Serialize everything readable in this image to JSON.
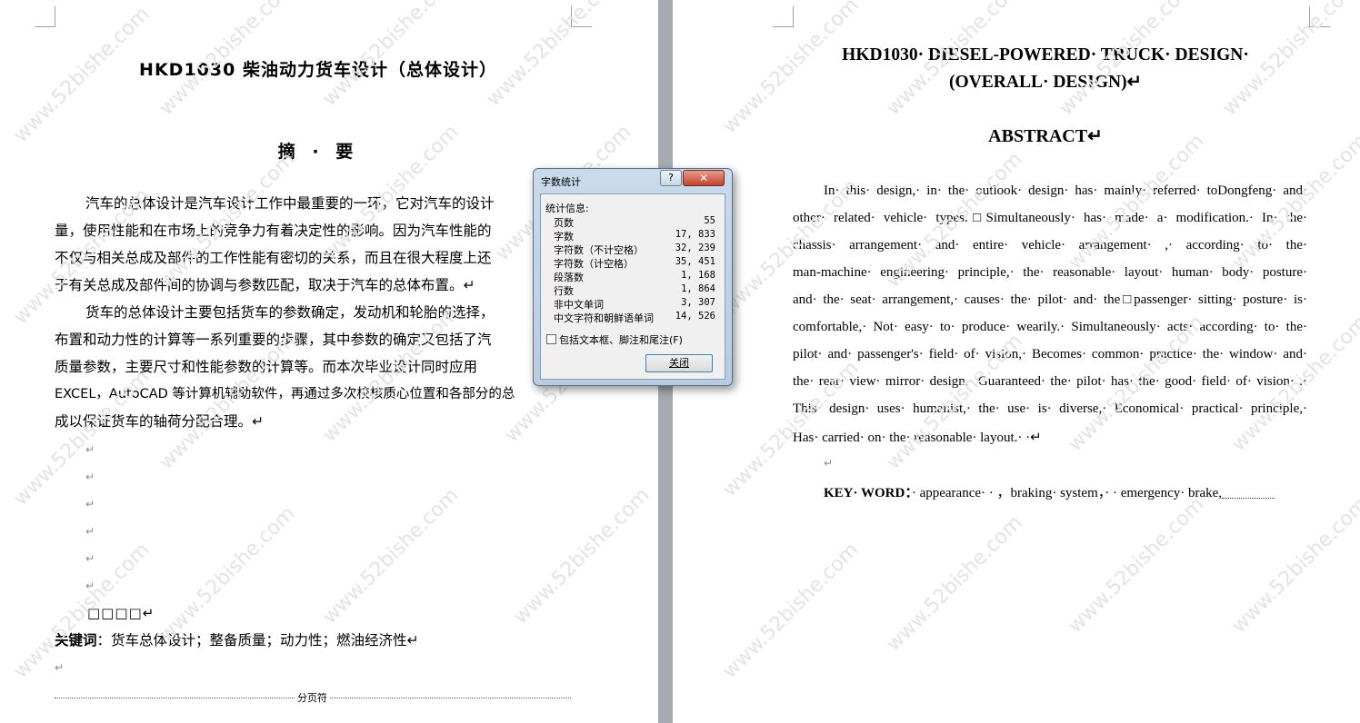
{
  "watermark": "www.52bishe.com",
  "paragraph_mark": "↵",
  "left_page": {
    "title": "HKD1030 柴油动力货车设计（总体设计）",
    "abstract_heading": "摘 · 要",
    "lines": [
      "汽车的总体设计是汽车设计工作中最重要的一环，它对汽车的设计",
      "量，使用性能和在市场上的竞争力有着决定性的影响。因为汽车性能的",
      "不仅与相关总成及部件的工作性能有密切的关系，而且在很大程度上还",
      "于有关总成及部件间的协调与参数匹配，取决于汽车的总体布置。↵",
      "货车的总体设计主要包括货车的参数确定，发动机和轮胎的选择，",
      "布置和动力性的计算等一系列重要的步骤，其中参数的确定又包括了汽",
      "质量参数，主要尺寸和性能参数的计算等。而本次毕业设计同时应用",
      "EXCEL，AutoCAD 等计算机辅助软件，再通过多次校核质心位置和各部分的总",
      "成以保证货车的轴荷分配合理。↵"
    ],
    "placeholder_boxes": "□□□□↵",
    "keywords_label": "关键词",
    "keywords_text": "：货车总体设计；整备质量；动力性；燃油经济性↵",
    "page_break_label": "分页符"
  },
  "right_page": {
    "title_line1": "HKD1030· DIESEL-POWERED· TRUCK· DESIGN·",
    "title_line2": "(OVERALL· DESIGN)↵",
    "abstract_heading": "ABSTRACT↵",
    "lines": [
      "In· this· design,· in· the· outlook· design· has· mainly· referred· toDongfeng· and·",
      "other· related· vehicle· types.□Simultaneously· has· made· a· modification.· In· the·",
      "chassis· arrangement· and· entire· vehicle· arrangement· ,· according· to· the·",
      "man-machine· engineering· principle,· the· reasonable· layout· human· body· posture·",
      "and· the· seat· arrangement,· causes· the· pilot· and· the□passenger· sitting· posture· is·",
      "comfortable,· Not· easy· to· produce· wearily.· Simultaneously· acts· according· to· the·",
      "pilot· and· passenger's· field· of· vision,· Becomes· common· practice· the· window· and·",
      "the· rear· view· mirror· design,· Guaranteed· the· pilot· has· the· good· field· of· vision· .·",
      "This· design· uses· humanist,· the· use· is· diverse,· Economical· practical· principle,·",
      "Has· carried· on· the· reasonable· layout.· ·↵"
    ],
    "keywords_label": "KEY· WORD：",
    "keywords_text": "· appearance· · ，braking· system，· · emergency· brake,"
  },
  "dialog": {
    "title": "字数统计",
    "help_label": "?",
    "close_x": "✕",
    "section_label": "统计信息:",
    "stats": [
      {
        "label": "页数",
        "value": "55"
      },
      {
        "label": "字数",
        "value": "17, 833"
      },
      {
        "label": "字符数（不计空格）",
        "value": "32, 239"
      },
      {
        "label": "字符数（计空格）",
        "value": "35, 451"
      },
      {
        "label": "段落数",
        "value": "1, 168"
      },
      {
        "label": "行数",
        "value": "1, 864"
      },
      {
        "label": "非中文单词",
        "value": "3, 307"
      },
      {
        "label": "中文字符和朝鲜语单词",
        "value": "14, 526"
      }
    ],
    "checkbox_label": "包括文本框、脚注和尾注(F)",
    "checkbox_checked": false,
    "close_button": "关闭"
  }
}
